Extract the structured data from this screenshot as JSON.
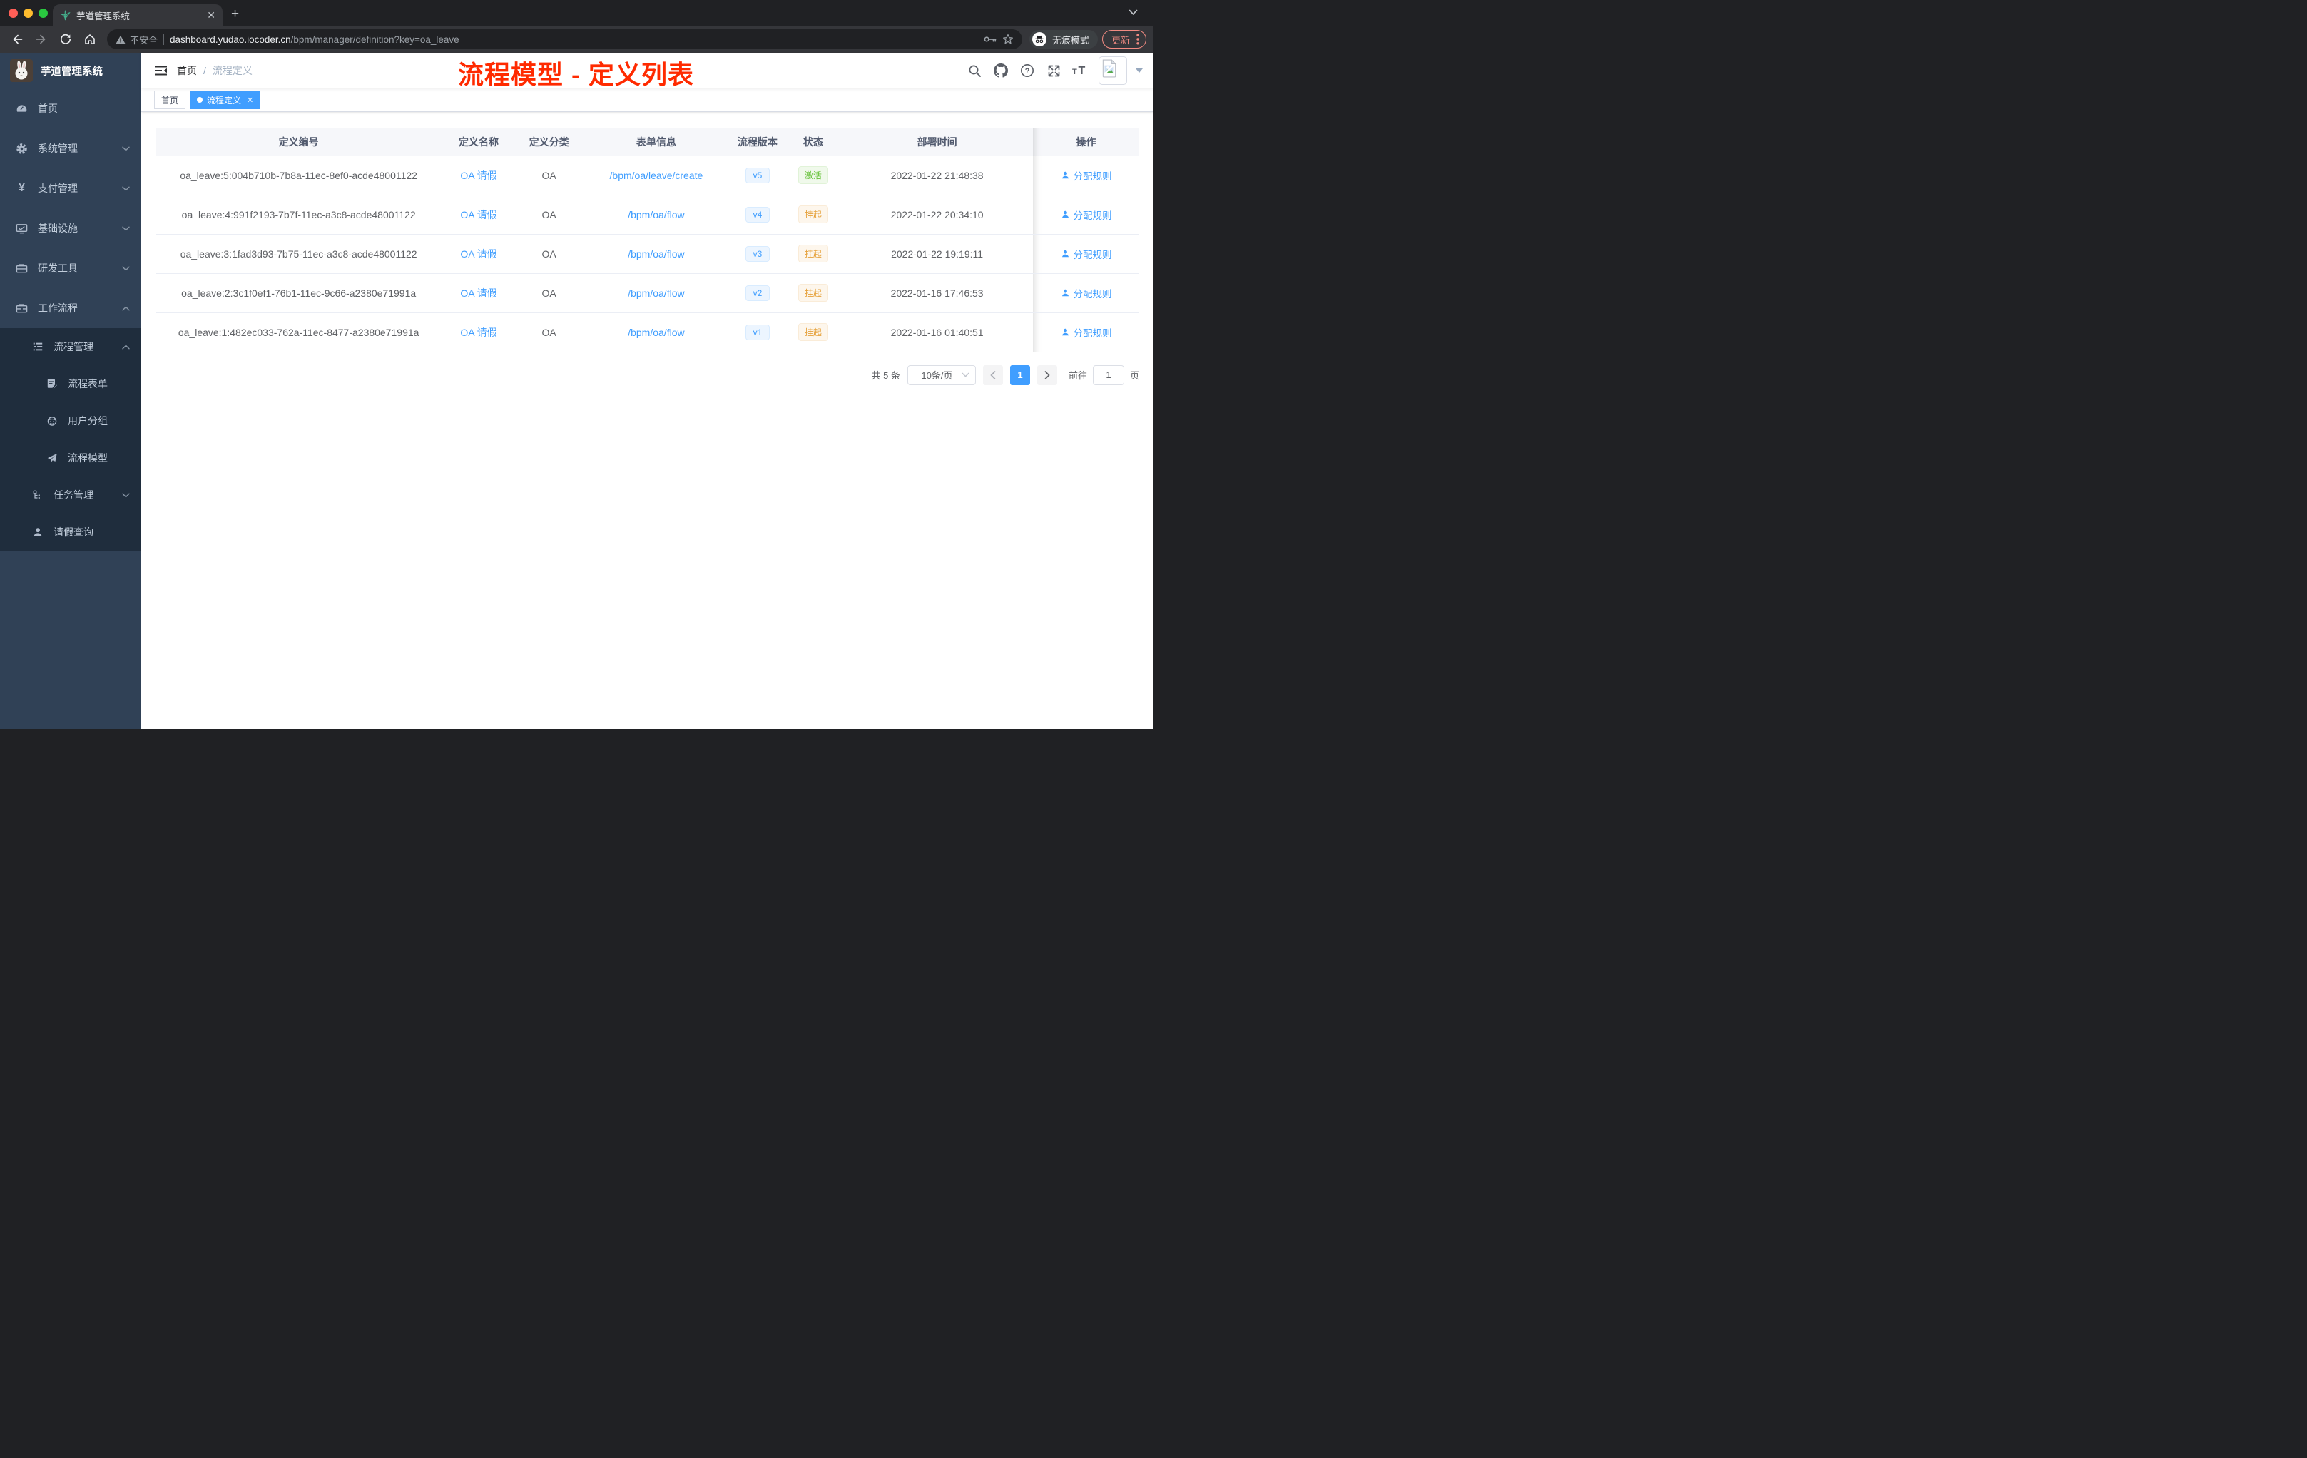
{
  "colors": {
    "accent": "#409eff",
    "sidebar_bg": "#304156",
    "submenu_bg": "#1f2d3d",
    "annotation_red": "#ff2a00",
    "success_green": "#67c23a",
    "warning_orange": "#e6a23c"
  },
  "browser": {
    "tab_title": "芋道管理系统",
    "security_label": "不安全",
    "url_domain": "dashboard.yudao.iocoder.cn",
    "url_path": "/bpm/manager/definition?key=oa_leave",
    "incognito_label": "无痕模式",
    "update_label": "更新"
  },
  "sidebar": {
    "logo_title": "芋道管理系统",
    "items": [
      {
        "label": "首页"
      },
      {
        "label": "系统管理"
      },
      {
        "label": "支付管理"
      },
      {
        "label": "基础设施"
      },
      {
        "label": "研发工具"
      },
      {
        "label": "工作流程"
      }
    ],
    "submenu": [
      {
        "label": "流程管理"
      },
      {
        "label": "流程表单"
      },
      {
        "label": "用户分组"
      },
      {
        "label": "流程模型"
      },
      {
        "label": "任务管理"
      },
      {
        "label": "请假查询"
      }
    ]
  },
  "navbar": {
    "breadcrumb": {
      "home": "首页",
      "current": "流程定义"
    },
    "annotation": "流程模型 - 定义列表"
  },
  "tags": {
    "home": "首页",
    "active": "流程定义"
  },
  "table": {
    "columns": [
      "定义编号",
      "定义名称",
      "定义分类",
      "表单信息",
      "流程版本",
      "状态",
      "部署时间",
      "操作"
    ],
    "rows": [
      {
        "id": "oa_leave:5:004b710b-7b8a-11ec-8ef0-acde48001122",
        "name": "OA 请假",
        "category": "OA",
        "form": "/bpm/oa/leave/create",
        "version": "v5",
        "status": "激活",
        "deploy_time": "2022-01-22 21:48:38",
        "action": "分配规则"
      },
      {
        "id": "oa_leave:4:991f2193-7b7f-11ec-a3c8-acde48001122",
        "name": "OA 请假",
        "category": "OA",
        "form": "/bpm/oa/flow",
        "version": "v4",
        "status": "挂起",
        "deploy_time": "2022-01-22 20:34:10",
        "action": "分配规则"
      },
      {
        "id": "oa_leave:3:1fad3d93-7b75-11ec-a3c8-acde48001122",
        "name": "OA 请假",
        "category": "OA",
        "form": "/bpm/oa/flow",
        "version": "v3",
        "status": "挂起",
        "deploy_time": "2022-01-22 19:19:11",
        "action": "分配规则"
      },
      {
        "id": "oa_leave:2:3c1f0ef1-76b1-11ec-9c66-a2380e71991a",
        "name": "OA 请假",
        "category": "OA",
        "form": "/bpm/oa/flow",
        "version": "v2",
        "status": "挂起",
        "deploy_time": "2022-01-16 17:46:53",
        "action": "分配规则"
      },
      {
        "id": "oa_leave:1:482ec033-762a-11ec-8477-a2380e71991a",
        "name": "OA 请假",
        "category": "OA",
        "form": "/bpm/oa/flow",
        "version": "v1",
        "status": "挂起",
        "deploy_time": "2022-01-16 01:40:51",
        "action": "分配规则"
      }
    ]
  },
  "pagination": {
    "total": "共 5 条",
    "page_size": "10条/页",
    "current_page": "1",
    "goto_label": "前往",
    "goto_value": "1",
    "page_unit": "页"
  }
}
